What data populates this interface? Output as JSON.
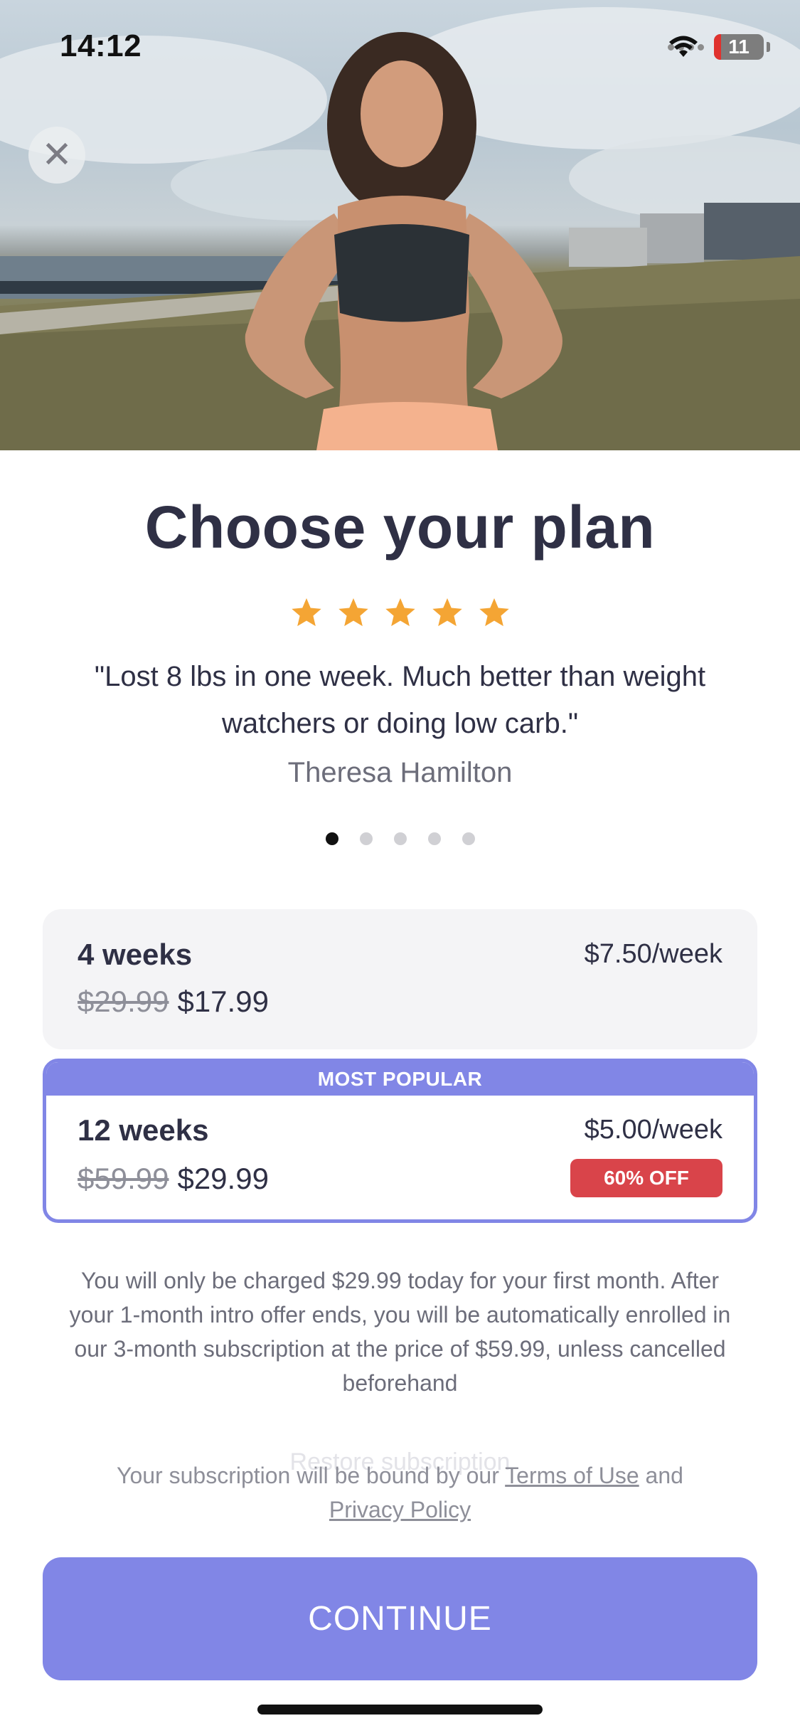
{
  "status_bar": {
    "time": "14:12",
    "battery_level": "11",
    "icons": [
      "cellular-signal-icon",
      "wifi-icon",
      "battery-icon"
    ]
  },
  "hero": {
    "image": "woman-in-sports-top-outdoor-photo",
    "close_icon": "close-icon",
    "close_glyph": "✕"
  },
  "header": {
    "title": "Choose your plan"
  },
  "review": {
    "rating": 5,
    "rating_max": 5,
    "star_icon": "star-icon",
    "star_color": "#f4a534",
    "quote": "\"Lost 8 lbs in one week. Much better than weight watchers or doing low carb.\"",
    "author": "Theresa Hamilton",
    "carousel_count": 5,
    "carousel_active": 1
  },
  "plans": [
    {
      "name": "4 weeks",
      "old_price": "$29.99",
      "price": "$17.99",
      "per_week": "$7.50/week",
      "selected": false
    },
    {
      "banner": "MOST POPULAR",
      "name": "12 weeks",
      "old_price": "$59.99",
      "price": "$29.99",
      "per_week": "$5.00/week",
      "badge": "60% OFF",
      "selected": true
    }
  ],
  "disclaimer": "You will only be charged $29.99 today for your first month. After your 1-month intro offer ends, you will be automatically enrolled in our 3-month subscription at the price of $59.99, unless cancelled beforehand",
  "restore_label": "Restore subscription",
  "terms": {
    "prefix": "Your subscription will be bound by our ",
    "terms_link": "Terms of Use",
    "conjunction": " and",
    "privacy_link": "Privacy Policy"
  },
  "cta": {
    "label": "CONTINUE"
  },
  "colors": {
    "accent": "#8186e6",
    "badge": "#d9444a",
    "title": "#2f3045",
    "star": "#f4a534"
  }
}
